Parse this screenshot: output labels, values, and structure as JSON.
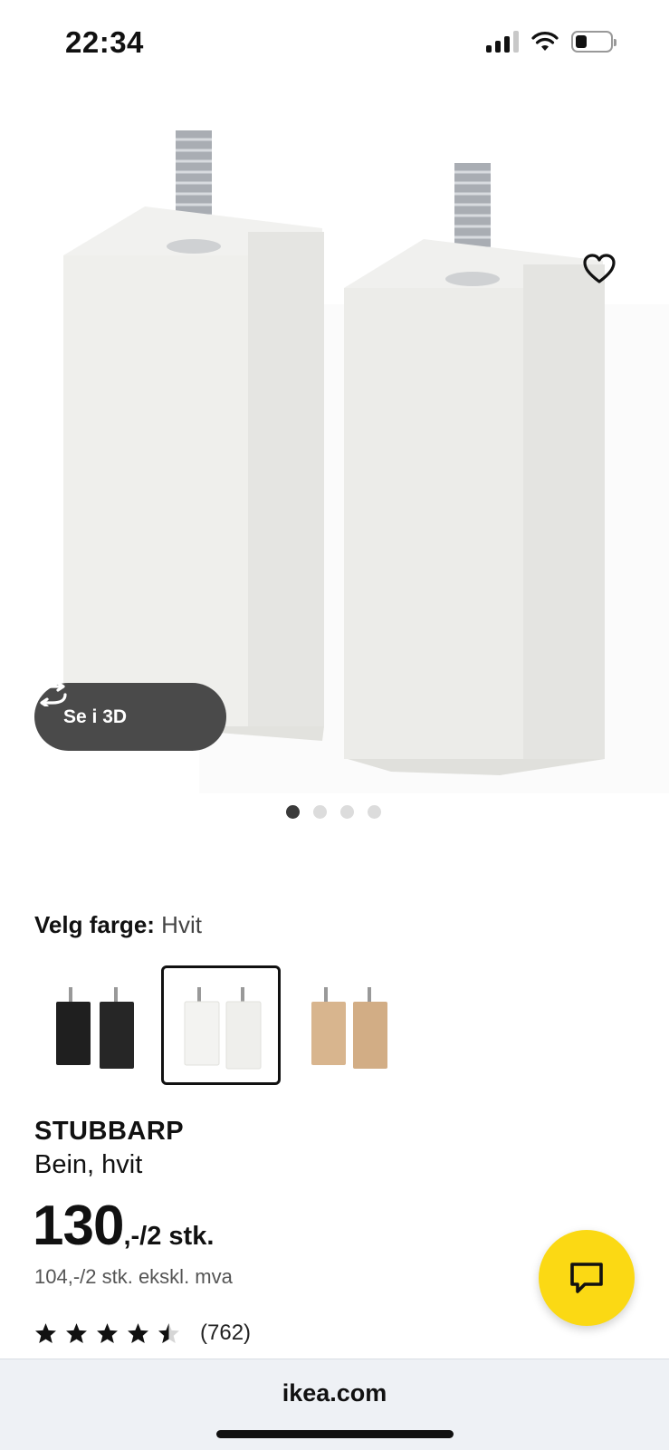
{
  "status_bar": {
    "time": "22:34"
  },
  "product_image": {
    "favorite_icon": "heart-icon",
    "view_3d_label": "Se i 3D",
    "view_3d_icon": "rotate-icon",
    "image_count": 4,
    "active_index": 0
  },
  "color_select": {
    "label": "Velg farge:",
    "selected_value": "Hvit",
    "options": [
      {
        "name": "black",
        "color": "#1f1f1f",
        "selected": false
      },
      {
        "name": "white",
        "color": "#f3f3f1",
        "selected": true
      },
      {
        "name": "birch",
        "color": "#d8b58e",
        "selected": false
      }
    ]
  },
  "product": {
    "name": "STUBBARP",
    "description": "Bein, hvit",
    "price_main": "130",
    "price_suffix": ",-/2 stk.",
    "price_ex_vat": "104,-/2 stk. ekskl. mva",
    "rating": 4.5,
    "rating_count": "(762)"
  },
  "chat": {
    "icon": "chat-icon",
    "color": "#fbd914"
  },
  "browser": {
    "url": "ikea.com"
  }
}
